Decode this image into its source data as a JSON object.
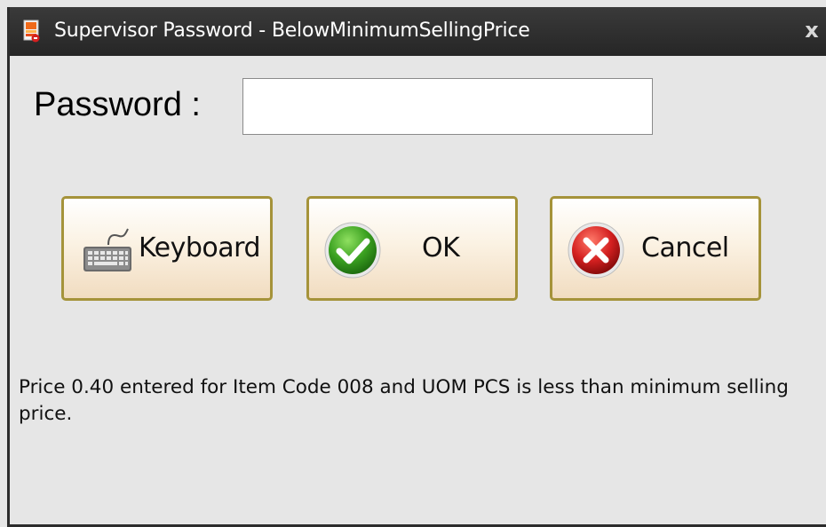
{
  "window": {
    "title": "Supervisor Password - BelowMinimumSellingPrice",
    "close_glyph": "x",
    "title_icon": "app-icon"
  },
  "form": {
    "password_label": "Password :",
    "password_value": "",
    "password_placeholder": ""
  },
  "buttons": {
    "keyboard": {
      "label": "Keyboard",
      "icon": "keyboard-icon"
    },
    "ok": {
      "label": "OK",
      "icon": "checkmark-icon"
    },
    "cancel": {
      "label": "Cancel",
      "icon": "cancel-x-icon"
    }
  },
  "message": "Price 0.40 entered for Item Code 008 and UOM PCS is less than minimum selling price.",
  "colors": {
    "titlebar": "#2f2f2f",
    "background": "#e6e6e6",
    "button_border": "#a5933a",
    "ok_green": "#3aa020",
    "cancel_red": "#d42020"
  }
}
